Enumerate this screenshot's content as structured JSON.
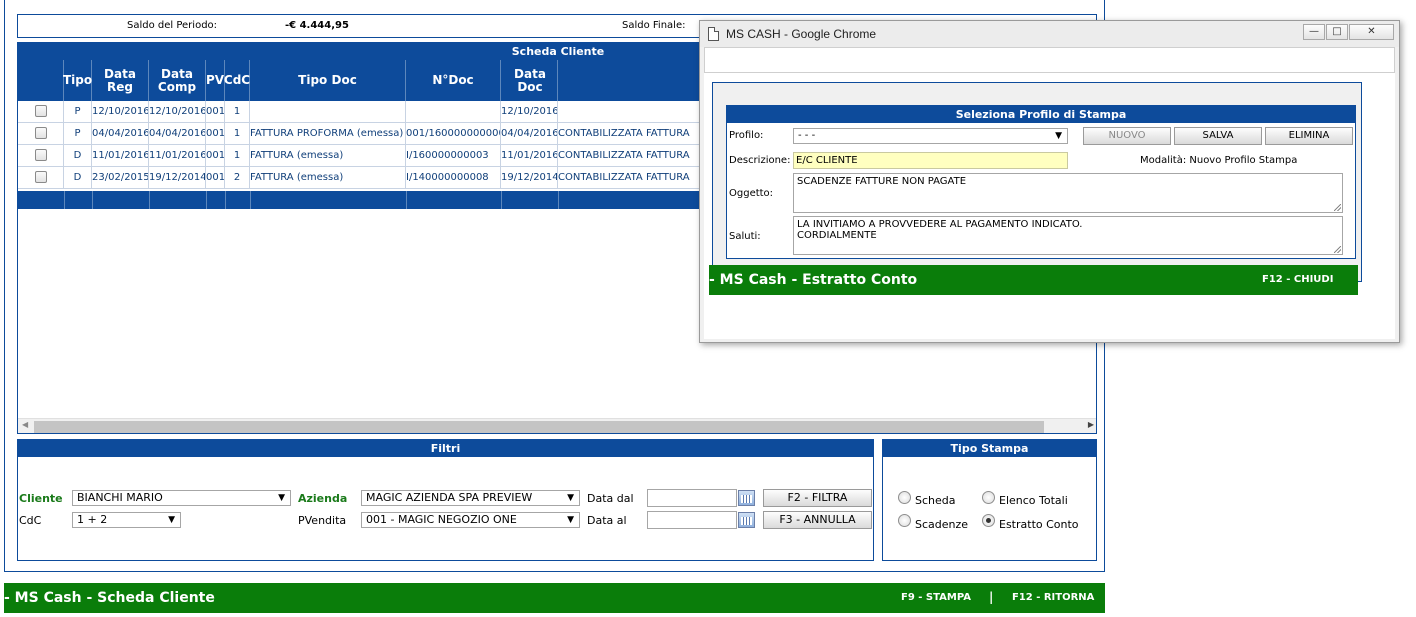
{
  "balance": {
    "saldo_periodo_label": "Saldo del Periodo:",
    "saldo_periodo_value": "-€ 4.444,95",
    "saldo_finale_label": "Saldo Finale:"
  },
  "grid": {
    "title": "Scheda Cliente",
    "columns": [
      "Tipo",
      "Data Reg",
      "Data\nComp",
      "PV",
      "CdC",
      "Tipo Doc",
      "N°Doc",
      "Data Doc"
    ],
    "rows": [
      {
        "tipo": "P",
        "data_reg": "12/10/2016",
        "data_comp": "12/10/2016",
        "pv": "001",
        "cdc": "1",
        "tipo_doc": "",
        "n_doc": "",
        "data_doc": "12/10/2016",
        "desc": ""
      },
      {
        "tipo": "P",
        "data_reg": "04/04/2016",
        "data_comp": "04/04/2016",
        "pv": "001",
        "cdc": "1",
        "tipo_doc": "FATTURA PROFORMA (emessa)",
        "n_doc": "001/1600000000001",
        "data_doc": "04/04/2016",
        "desc": "CONTABILIZZATA FATTURA"
      },
      {
        "tipo": "D",
        "data_reg": "11/01/2016",
        "data_comp": "11/01/2016",
        "pv": "001",
        "cdc": "1",
        "tipo_doc": "FATTURA (emessa)",
        "n_doc": "I/160000000003",
        "data_doc": "11/01/2016",
        "desc": "CONTABILIZZATA FATTURA"
      },
      {
        "tipo": "D",
        "data_reg": "23/02/2015",
        "data_comp": "19/12/2014",
        "pv": "001",
        "cdc": "2",
        "tipo_doc": "FATTURA (emessa)",
        "n_doc": "I/140000000008",
        "data_doc": "19/12/2014",
        "desc": "CONTABILIZZATA FATTURA"
      }
    ]
  },
  "filters": {
    "title": "Filtri",
    "cliente_label": "Cliente",
    "cliente_value": "BIANCHI MARIO",
    "cdc_label": "CdC",
    "cdc_value": "1 + 2",
    "azienda_label": "Azienda",
    "azienda_value": "MAGIC AZIENDA SPA PREVIEW",
    "pvendita_label": "PVendita",
    "pvendita_value": "001 - MAGIC NEGOZIO ONE",
    "data_dal_label": "Data dal",
    "data_al_label": "Data al",
    "filtra_button": "F2 - FILTRA",
    "annulla_button": "F3 - ANNULLA"
  },
  "tipo_stampa": {
    "title": "Tipo Stampa",
    "options": [
      {
        "label": "Scheda",
        "selected": false
      },
      {
        "label": "Elenco Totali",
        "selected": false
      },
      {
        "label": "Scadenze",
        "selected": false
      },
      {
        "label": "Estratto Conto",
        "selected": true
      }
    ]
  },
  "bottom_bar": {
    "title": "- MS Cash - Scheda Cliente",
    "stampa": "F9 - STAMPA",
    "separator": "|",
    "ritorna": "F12 - RITORNA"
  },
  "popup": {
    "window_title": "MS CASH - Google Chrome",
    "panel_title": "Seleziona Profilo di Stampa",
    "profilo_label": "Profilo:",
    "profilo_value": "- - -",
    "nuovo_button": "NUOVO",
    "salva_button": "SALVA",
    "elimina_button": "ELIMINA",
    "descrizione_label": "Descrizione:",
    "descrizione_value": "E/C CLIENTE",
    "modalita_text": "Modalità: Nuovo Profilo Stampa",
    "oggetto_label": "Oggetto:",
    "oggetto_value": "SCADENZE FATTURE NON PAGATE",
    "saluti_label": "Saluti:",
    "saluti_value": "LA INVITIAMO A PROVVEDERE AL PAGAMENTO INDICATO.\nCORDIALMENTE",
    "bottom_title": "- MS Cash - Estratto Conto",
    "chiudi": "F12 - CHIUDI"
  },
  "colors": {
    "navy": "#0d4b9b",
    "green": "#0a7d0a",
    "highlight_yellow": "#ffffc0"
  },
  "icons": [
    "checkbox-icon",
    "dropdown-arrow-icon",
    "calendar-icon",
    "radio-icon",
    "document-icon",
    "minimize-icon",
    "maximize-icon",
    "close-icon",
    "scroll-left-icon",
    "scroll-right-icon"
  ]
}
